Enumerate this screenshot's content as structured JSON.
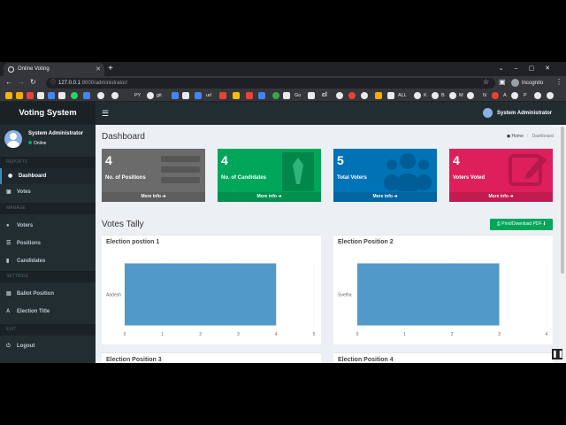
{
  "browser": {
    "tab_title": "Online Voting",
    "url_host": "127.0.0.1",
    "url_rest": ":8000/administrator/",
    "profile": "Incognito",
    "bookmarks": [
      "PY",
      "git",
      "url",
      "Go",
      "cl",
      "ALL",
      "K",
      "B",
      "M",
      "N",
      "A",
      "P"
    ]
  },
  "app": {
    "brand": "Voting System",
    "user_name": "System Administrator",
    "user_status": "Online",
    "admin_name": "System Administrator"
  },
  "sidebar": {
    "sections": [
      {
        "title": "REPORTS",
        "items": [
          {
            "label": "Dashboard",
            "icon": "dashboard-icon",
            "active": true
          },
          {
            "label": "Votes",
            "icon": "lock-icon"
          }
        ]
      },
      {
        "title": "MANAGE",
        "items": [
          {
            "label": "Voters",
            "icon": "users-icon"
          },
          {
            "label": "Positions",
            "icon": "tasks-icon"
          },
          {
            "label": "Candidates",
            "icon": "black-tie-icon"
          }
        ]
      },
      {
        "title": "SETTINGS",
        "items": [
          {
            "label": "Ballot Position",
            "icon": "file-icon"
          },
          {
            "label": "Election Title",
            "icon": "cog-icon"
          }
        ]
      },
      {
        "title": "EXIT",
        "items": [
          {
            "label": "Logout",
            "icon": "power-icon"
          }
        ]
      }
    ]
  },
  "page": {
    "title": "Dashboard",
    "breadcrumb_home": "Home",
    "breadcrumb_current": "Dashboard"
  },
  "stats": [
    {
      "value": "4",
      "label": "No. of Positions",
      "footer": "More info",
      "color": "#6b6b6b",
      "icon": "tasks-icon"
    },
    {
      "value": "4",
      "label": "No. of Candidates",
      "footer": "More info",
      "color": "#00a65a",
      "icon": "tie-icon"
    },
    {
      "value": "5",
      "label": "Total Voters",
      "footer": "More info",
      "color": "#0073b7",
      "icon": "users-icon"
    },
    {
      "value": "4",
      "label": "Voters Voted",
      "footer": "More info",
      "color": "#dd1f5c",
      "icon": "edit-icon"
    }
  ],
  "tally": {
    "title": "Votes Tally",
    "pdf_button": "Print/Download PDF"
  },
  "chart_data": [
    {
      "type": "bar",
      "title": "Election postion 1",
      "categories": [
        "Aadesh"
      ],
      "values": [
        4
      ],
      "xlim": [
        0,
        5
      ],
      "xticks": [
        "0",
        "1",
        "2",
        "3",
        "4",
        "5"
      ],
      "orientation": "horizontal",
      "color": "#5199c9"
    },
    {
      "type": "bar",
      "title": "Election Position 2",
      "categories": [
        "Svetha"
      ],
      "values": [
        3
      ],
      "xlim": [
        0,
        4
      ],
      "xticks": [
        "0",
        "1",
        "2",
        "3",
        "4"
      ],
      "orientation": "horizontal",
      "color": "#5199c9"
    },
    {
      "type": "bar",
      "title": "Election Position 3",
      "categories": [],
      "values": []
    },
    {
      "type": "bar",
      "title": "Election Position 4",
      "categories": [],
      "values": []
    }
  ]
}
